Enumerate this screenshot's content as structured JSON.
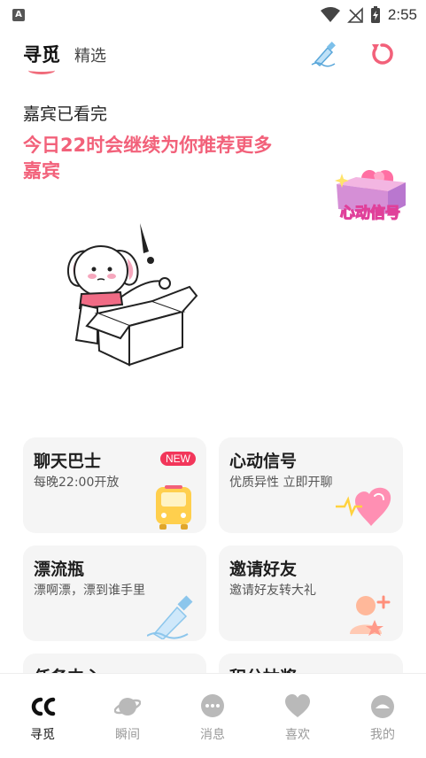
{
  "status_bar": {
    "indicator": "A",
    "time": "2:55"
  },
  "tabs": [
    {
      "label": "寻觅"
    },
    {
      "label": "精选"
    }
  ],
  "hero": {
    "title": "嘉宾已看完",
    "message": "今日22时会继续为你推荐更多嘉宾",
    "badge_text": "心动信号"
  },
  "cards": [
    {
      "title": "聊天巴士",
      "subtitle": "每晚22:00开放",
      "badge": "NEW",
      "icon": "bus-icon"
    },
    {
      "title": "心动信号",
      "subtitle": "优质异性 立即开聊",
      "icon": "heart-icon"
    },
    {
      "title": "漂流瓶",
      "subtitle": "漂啊漂，漂到谁手里",
      "icon": "bottle-icon"
    },
    {
      "title": "邀请好友",
      "subtitle": "邀请好友转大礼",
      "icon": "invite-user-icon"
    },
    {
      "title": "任务中心"
    },
    {
      "title": "积分抽奖"
    }
  ],
  "bottom_nav": [
    {
      "label": "寻觅",
      "icon": "cc-logo-icon",
      "active": true
    },
    {
      "label": "瞬间",
      "icon": "planet-icon"
    },
    {
      "label": "消息",
      "icon": "chat-bubble-icon"
    },
    {
      "label": "喜欢",
      "icon": "heart-icon"
    },
    {
      "label": "我的",
      "icon": "profile-icon"
    }
  ],
  "colors": {
    "accent": "#f2617a",
    "new_badge": "#f2365a",
    "card_bg": "#f5f5f5",
    "nav_inactive": "#9a9a9a"
  }
}
